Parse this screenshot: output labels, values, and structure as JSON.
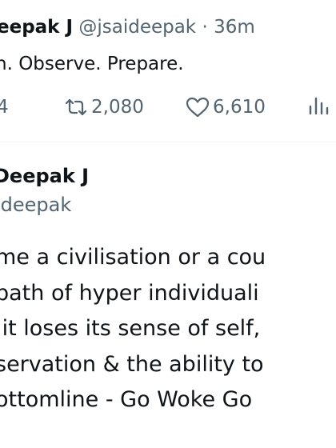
{
  "quoted_tweet": {
    "author_name": "eepak J",
    "author_handle": "@jsaideepak",
    "separator": "·",
    "timestamp": "36m",
    "text": "h. Observe. Prepare.",
    "metrics": {
      "replies": "4",
      "reposts": "2,080",
      "likes": "6,610"
    }
  },
  "tweet": {
    "author_name": "Deepak J",
    "author_handle": "ideepak",
    "body_lines": [
      "me a civilisation or a cou",
      "path of hyper individuali",
      ",it loses its sense of self,",
      "servation & the ability to",
      "ottomline - Go Woke Go"
    ]
  },
  "icons": {
    "reply": "reply-icon",
    "repost": "repost-icon",
    "like": "heart-icon",
    "views": "views-chart-icon"
  },
  "colors": {
    "text_primary": "#0f1419",
    "text_secondary": "#536471",
    "divider": "#eff3f4",
    "background": "#ffffff"
  }
}
